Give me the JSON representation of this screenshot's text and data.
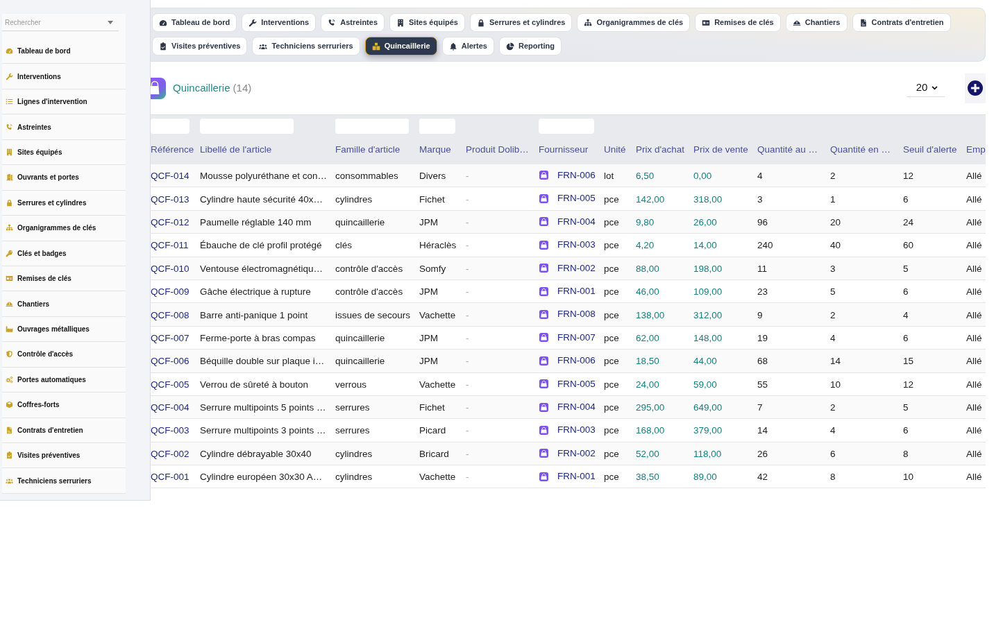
{
  "sidebar": {
    "search": {
      "placeholder": "Rechercher"
    },
    "items": [
      {
        "label": "Tableau de bord"
      },
      {
        "label": "Interventions"
      },
      {
        "label": "Lignes d'intervention"
      },
      {
        "label": "Astreintes"
      },
      {
        "label": "Sites équipés"
      },
      {
        "label": "Ouvrants et portes"
      },
      {
        "label": "Serrures et cylindres"
      },
      {
        "label": "Organigrammes de clés"
      },
      {
        "label": "Clés et badges"
      },
      {
        "label": "Remises de clés"
      },
      {
        "label": "Chantiers"
      },
      {
        "label": "Ouvrages métalliques"
      },
      {
        "label": "Contrôle d'accès"
      },
      {
        "label": "Portes automatiques"
      },
      {
        "label": "Coffres-forts"
      },
      {
        "label": "Contrats d'entretien"
      },
      {
        "label": "Visites préventives"
      },
      {
        "label": "Techniciens serruriers"
      }
    ]
  },
  "tabs": [
    {
      "label": "Tableau de bord",
      "selected": false
    },
    {
      "label": "Interventions",
      "selected": false
    },
    {
      "label": "Astreintes",
      "selected": false
    },
    {
      "label": "Sites équipés",
      "selected": false
    },
    {
      "label": "Serrures et cylindres",
      "selected": false
    },
    {
      "label": "Organigrammes de clés",
      "selected": false
    },
    {
      "label": "Remises de clés",
      "selected": false
    },
    {
      "label": "Chantiers",
      "selected": false
    },
    {
      "label": "Contrats d'entretien",
      "selected": false
    },
    {
      "label": "Visites préventives",
      "selected": false
    },
    {
      "label": "Techniciens serruriers",
      "selected": false
    },
    {
      "label": "Quincaillerie",
      "selected": true
    },
    {
      "label": "Alertes",
      "selected": false
    },
    {
      "label": "Reporting",
      "selected": false
    }
  ],
  "header": {
    "title": "Quincaillerie",
    "count": "(14)",
    "page_size": {
      "value": "20"
    }
  },
  "table": {
    "columns": [
      {
        "label": "Référence",
        "filter": true,
        "kind": "link"
      },
      {
        "label": "Libellé de l'article",
        "filter": true,
        "kind": "text"
      },
      {
        "label": "Famille d'article",
        "filter": true,
        "kind": "text"
      },
      {
        "label": "Marque",
        "filter": true,
        "kind": "text"
      },
      {
        "label": "Produit Dolib…",
        "filter": false,
        "kind": "muted"
      },
      {
        "label": "Fournisseur",
        "filter": true,
        "kind": "supplier"
      },
      {
        "label": "Unité",
        "filter": false,
        "kind": "text"
      },
      {
        "label": "Prix d'achat",
        "filter": false,
        "kind": "price"
      },
      {
        "label": "Prix de vente",
        "filter": false,
        "kind": "price"
      },
      {
        "label": "Quantité au …",
        "filter": false,
        "kind": "text"
      },
      {
        "label": "Quantité en …",
        "filter": false,
        "kind": "text"
      },
      {
        "label": "Seuil d'alerte",
        "filter": false,
        "kind": "text"
      },
      {
        "label": "Emp",
        "filter": false,
        "kind": "text"
      }
    ],
    "rows": [
      [
        "QCF-014",
        "Mousse polyuréthane et con…",
        "consommables",
        "Divers",
        "-",
        "FRN-006",
        "lot",
        "6,50",
        "0,00",
        "4",
        "2",
        "12",
        "Allé"
      ],
      [
        "QCF-013",
        "Cylindre haute sécurité 40x…",
        "cylindres",
        "Fichet",
        "-",
        "FRN-005",
        "pce",
        "142,00",
        "318,00",
        "3",
        "1",
        "6",
        "Allé"
      ],
      [
        "QCF-012",
        "Paumelle réglable 140 mm",
        "quincaillerie",
        "JPM",
        "-",
        "FRN-004",
        "pce",
        "9,80",
        "26,00",
        "96",
        "20",
        "24",
        "Allé"
      ],
      [
        "QCF-011",
        "Ébauche de clé profil protégé",
        "clés",
        "Héraclès",
        "-",
        "FRN-003",
        "pce",
        "4,20",
        "14,00",
        "240",
        "40",
        "60",
        "Allé"
      ],
      [
        "QCF-010",
        "Ventouse électromagnétiqu…",
        "contrôle d'accès",
        "Somfy",
        "-",
        "FRN-002",
        "pce",
        "88,00",
        "198,00",
        "11",
        "3",
        "5",
        "Allé"
      ],
      [
        "QCF-009",
        "Gâche électrique à rupture",
        "contrôle d'accès",
        "JPM",
        "-",
        "FRN-001",
        "pce",
        "46,00",
        "109,00",
        "23",
        "5",
        "6",
        "Allé"
      ],
      [
        "QCF-008",
        "Barre anti-panique 1 point",
        "issues de secours",
        "Vachette",
        "-",
        "FRN-008",
        "pce",
        "138,00",
        "312,00",
        "9",
        "2",
        "4",
        "Allé"
      ],
      [
        "QCF-007",
        "Ferme-porte à bras compas",
        "quincaillerie",
        "JPM",
        "-",
        "FRN-007",
        "pce",
        "62,00",
        "148,00",
        "19",
        "4",
        "6",
        "Allé"
      ],
      [
        "QCF-006",
        "Béquille double sur plaque i…",
        "quincaillerie",
        "JPM",
        "-",
        "FRN-006",
        "pce",
        "18,50",
        "44,00",
        "68",
        "14",
        "15",
        "Allé"
      ],
      [
        "QCF-005",
        "Verrou de sûreté à bouton",
        "verrous",
        "Vachette",
        "-",
        "FRN-005",
        "pce",
        "24,00",
        "59,00",
        "55",
        "10",
        "12",
        "Allé"
      ],
      [
        "QCF-004",
        "Serrure multipoints 5 points …",
        "serrures",
        "Fichet",
        "-",
        "FRN-004",
        "pce",
        "295,00",
        "649,00",
        "7",
        "2",
        "5",
        "Allé"
      ],
      [
        "QCF-003",
        "Serrure multipoints 3 points …",
        "serrures",
        "Picard",
        "-",
        "FRN-003",
        "pce",
        "168,00",
        "379,00",
        "14",
        "4",
        "6",
        "Allé"
      ],
      [
        "QCF-002",
        "Cylindre débrayable 30x40",
        "cylindres",
        "Bricard",
        "-",
        "FRN-002",
        "pce",
        "52,00",
        "118,00",
        "26",
        "6",
        "8",
        "Allé"
      ],
      [
        "QCF-001",
        "Cylindre européen 30x30 A…",
        "cylindres",
        "Vachette",
        "-",
        "FRN-001",
        "pce",
        "38,50",
        "89,00",
        "42",
        "8",
        "10",
        "Allé"
      ]
    ]
  }
}
